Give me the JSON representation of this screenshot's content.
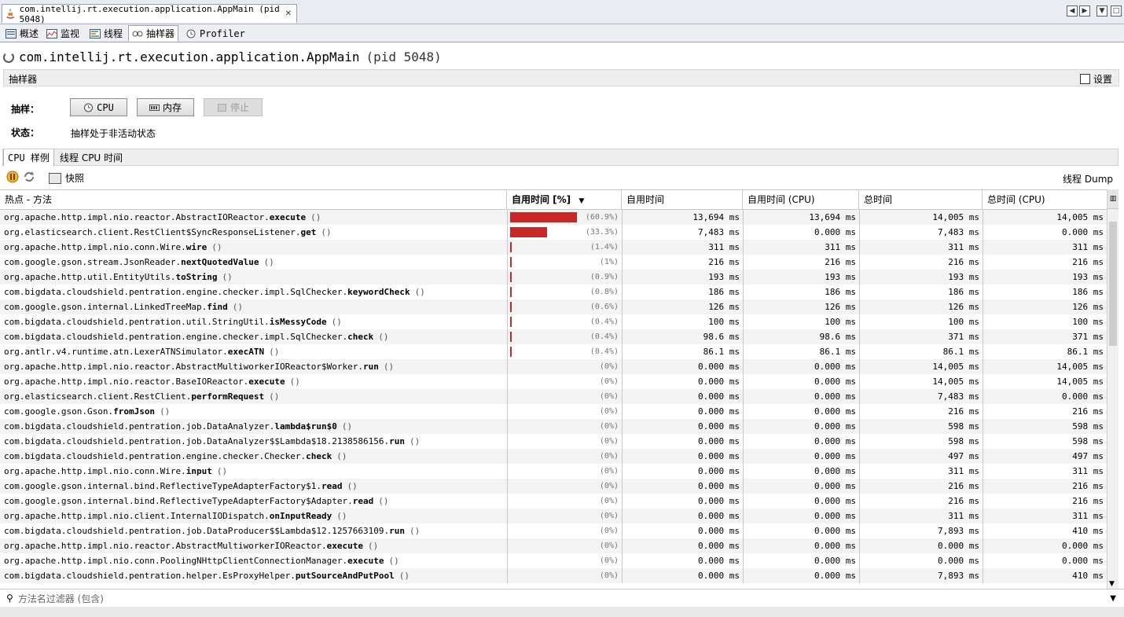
{
  "document_tab": {
    "title": "com.intellij.rt.execution.application.AppMain (pid 5048)",
    "close": "✕"
  },
  "view_tabs": [
    {
      "label": "概述"
    },
    {
      "label": "监视"
    },
    {
      "label": "线程"
    },
    {
      "label": "抽样器"
    },
    {
      "label": "Profiler"
    }
  ],
  "header": {
    "app_name": "com.intellij.rt.execution.application.AppMain",
    "pid": "(pid 5048)"
  },
  "sampler_section": {
    "title": "抽样器",
    "settings_label": "设置"
  },
  "sampling": {
    "label": "抽样：",
    "cpu_button": "CPU",
    "memory_button": "内存",
    "stop_button": "停止",
    "status_label": "状态：",
    "status_value": "抽样处于非活动状态"
  },
  "sub_tabs": [
    {
      "label": "CPU 样例"
    },
    {
      "label": "线程 CPU 时间"
    }
  ],
  "toolbar": {
    "snapshot_label": "快照",
    "thread_dump_label": "线程 Dump"
  },
  "table": {
    "columns": [
      "热点 - 方法",
      "自用时间 [%]",
      "自用时间",
      "自用时间 (CPU)",
      "总时间",
      "总时间 (CPU)"
    ],
    "sort_indicator": "▼",
    "rows": [
      {
        "pkg": "org.apache.http.impl.nio.reactor.AbstractIOReactor.",
        "method": "execute",
        "args": "()",
        "self": "13,694 ms",
        "pct": "(60.9%)",
        "frac": 0.609,
        "self_cpu": "13,694 ms",
        "total": "14,005 ms",
        "total_cpu": "14,005 ms"
      },
      {
        "pkg": "org.elasticsearch.client.RestClient$SyncResponseListener.",
        "method": "get",
        "args": "()",
        "self": "7,483 ms",
        "pct": "(33.3%)",
        "frac": 0.333,
        "self_cpu": "0.000 ms",
        "total": "7,483 ms",
        "total_cpu": "0.000 ms"
      },
      {
        "pkg": "org.apache.http.impl.nio.conn.Wire.",
        "method": "wire",
        "args": "()",
        "self": "311 ms",
        "pct": "(1.4%)",
        "frac": 0.014,
        "self_cpu": "311 ms",
        "total": "311 ms",
        "total_cpu": "311 ms"
      },
      {
        "pkg": "com.google.gson.stream.JsonReader.",
        "method": "nextQuotedValue",
        "args": "()",
        "self": "216 ms",
        "pct": "(1%)",
        "frac": 0.01,
        "self_cpu": "216 ms",
        "total": "216 ms",
        "total_cpu": "216 ms"
      },
      {
        "pkg": "org.apache.http.util.EntityUtils.",
        "method": "toString",
        "args": "()",
        "self": "193 ms",
        "pct": "(0.9%)",
        "frac": 0.009,
        "self_cpu": "193 ms",
        "total": "193 ms",
        "total_cpu": "193 ms"
      },
      {
        "pkg": "com.bigdata.cloudshield.pentration.engine.checker.impl.SqlChecker.",
        "method": "keywordCheck",
        "args": "()",
        "self": "186 ms",
        "pct": "(0.8%)",
        "frac": 0.008,
        "self_cpu": "186 ms",
        "total": "186 ms",
        "total_cpu": "186 ms"
      },
      {
        "pkg": "com.google.gson.internal.LinkedTreeMap.",
        "method": "find",
        "args": "()",
        "self": "126 ms",
        "pct": "(0.6%)",
        "frac": 0.006,
        "self_cpu": "126 ms",
        "total": "126 ms",
        "total_cpu": "126 ms"
      },
      {
        "pkg": "com.bigdata.cloudshield.pentration.util.StringUtil.",
        "method": "isMessyCode",
        "args": "()",
        "self": "100 ms",
        "pct": "(0.4%)",
        "frac": 0.004,
        "self_cpu": "100 ms",
        "total": "100 ms",
        "total_cpu": "100 ms"
      },
      {
        "pkg": "com.bigdata.cloudshield.pentration.engine.checker.impl.SqlChecker.",
        "method": "check",
        "args": "()",
        "self": "98.6 ms",
        "pct": "(0.4%)",
        "frac": 0.004,
        "self_cpu": "98.6 ms",
        "total": "371 ms",
        "total_cpu": "371 ms"
      },
      {
        "pkg": "org.antlr.v4.runtime.atn.LexerATNSimulator.",
        "method": "execATN",
        "args": "()",
        "self": "86.1 ms",
        "pct": "(0.4%)",
        "frac": 0.004,
        "self_cpu": "86.1 ms",
        "total": "86.1 ms",
        "total_cpu": "86.1 ms"
      },
      {
        "pkg": "org.apache.http.impl.nio.reactor.AbstractMultiworkerIOReactor$Worker.",
        "method": "run",
        "args": "()",
        "self": "0.000 ms",
        "pct": "(0%)",
        "frac": 0,
        "self_cpu": "0.000 ms",
        "total": "14,005 ms",
        "total_cpu": "14,005 ms"
      },
      {
        "pkg": "org.apache.http.impl.nio.reactor.BaseIOReactor.",
        "method": "execute",
        "args": "()",
        "self": "0.000 ms",
        "pct": "(0%)",
        "frac": 0,
        "self_cpu": "0.000 ms",
        "total": "14,005 ms",
        "total_cpu": "14,005 ms"
      },
      {
        "pkg": "org.elasticsearch.client.RestClient.",
        "method": "performRequest",
        "args": "()",
        "self": "0.000 ms",
        "pct": "(0%)",
        "frac": 0,
        "self_cpu": "0.000 ms",
        "total": "7,483 ms",
        "total_cpu": "0.000 ms"
      },
      {
        "pkg": "com.google.gson.Gson.",
        "method": "fromJson",
        "args": "()",
        "self": "0.000 ms",
        "pct": "(0%)",
        "frac": 0,
        "self_cpu": "0.000 ms",
        "total": "216 ms",
        "total_cpu": "216 ms"
      },
      {
        "pkg": "com.bigdata.cloudshield.pentration.job.DataAnalyzer.",
        "method": "lambda$run$0",
        "args": "()",
        "self": "0.000 ms",
        "pct": "(0%)",
        "frac": 0,
        "self_cpu": "0.000 ms",
        "total": "598 ms",
        "total_cpu": "598 ms"
      },
      {
        "pkg": "com.bigdata.cloudshield.pentration.job.DataAnalyzer$$Lambda$18.2138586156.",
        "method": "run",
        "args": "()",
        "self": "0.000 ms",
        "pct": "(0%)",
        "frac": 0,
        "self_cpu": "0.000 ms",
        "total": "598 ms",
        "total_cpu": "598 ms"
      },
      {
        "pkg": "com.bigdata.cloudshield.pentration.engine.checker.Checker.",
        "method": "check",
        "args": "()",
        "self": "0.000 ms",
        "pct": "(0%)",
        "frac": 0,
        "self_cpu": "0.000 ms",
        "total": "497 ms",
        "total_cpu": "497 ms"
      },
      {
        "pkg": "org.apache.http.impl.nio.conn.Wire.",
        "method": "input",
        "args": "()",
        "self": "0.000 ms",
        "pct": "(0%)",
        "frac": 0,
        "self_cpu": "0.000 ms",
        "total": "311 ms",
        "total_cpu": "311 ms"
      },
      {
        "pkg": "com.google.gson.internal.bind.ReflectiveTypeAdapterFactory$1.",
        "method": "read",
        "args": "()",
        "self": "0.000 ms",
        "pct": "(0%)",
        "frac": 0,
        "self_cpu": "0.000 ms",
        "total": "216 ms",
        "total_cpu": "216 ms"
      },
      {
        "pkg": "com.google.gson.internal.bind.ReflectiveTypeAdapterFactory$Adapter.",
        "method": "read",
        "args": "()",
        "self": "0.000 ms",
        "pct": "(0%)",
        "frac": 0,
        "self_cpu": "0.000 ms",
        "total": "216 ms",
        "total_cpu": "216 ms"
      },
      {
        "pkg": "org.apache.http.impl.nio.client.InternalIODispatch.",
        "method": "onInputReady",
        "args": "()",
        "self": "0.000 ms",
        "pct": "(0%)",
        "frac": 0,
        "self_cpu": "0.000 ms",
        "total": "311 ms",
        "total_cpu": "311 ms"
      },
      {
        "pkg": "com.bigdata.cloudshield.pentration.job.DataProducer$$Lambda$12.1257663109.",
        "method": "run",
        "args": "()",
        "self": "0.000 ms",
        "pct": "(0%)",
        "frac": 0,
        "self_cpu": "0.000 ms",
        "total": "7,893 ms",
        "total_cpu": "410 ms"
      },
      {
        "pkg": "org.apache.http.impl.nio.reactor.AbstractMultiworkerIOReactor.",
        "method": "execute",
        "args": "()",
        "self": "0.000 ms",
        "pct": "(0%)",
        "frac": 0,
        "self_cpu": "0.000 ms",
        "total": "0.000 ms",
        "total_cpu": "0.000 ms"
      },
      {
        "pkg": "org.apache.http.impl.nio.conn.PoolingNHttpClientConnectionManager.",
        "method": "execute",
        "args": "()",
        "self": "0.000 ms",
        "pct": "(0%)",
        "frac": 0,
        "self_cpu": "0.000 ms",
        "total": "0.000 ms",
        "total_cpu": "0.000 ms"
      },
      {
        "pkg": "com.bigdata.cloudshield.pentration.helper.EsProxyHelper.",
        "method": "putSourceAndPutPool",
        "args": "()",
        "self": "0.000 ms",
        "pct": "(0%)",
        "frac": 0,
        "self_cpu": "0.000 ms",
        "total": "7,893 ms",
        "total_cpu": "410 ms"
      }
    ]
  },
  "filter": {
    "placeholder": "方法名过滤器 (包含)"
  },
  "colors": {
    "bar": "#c62828",
    "accent": "#3c6db0"
  }
}
